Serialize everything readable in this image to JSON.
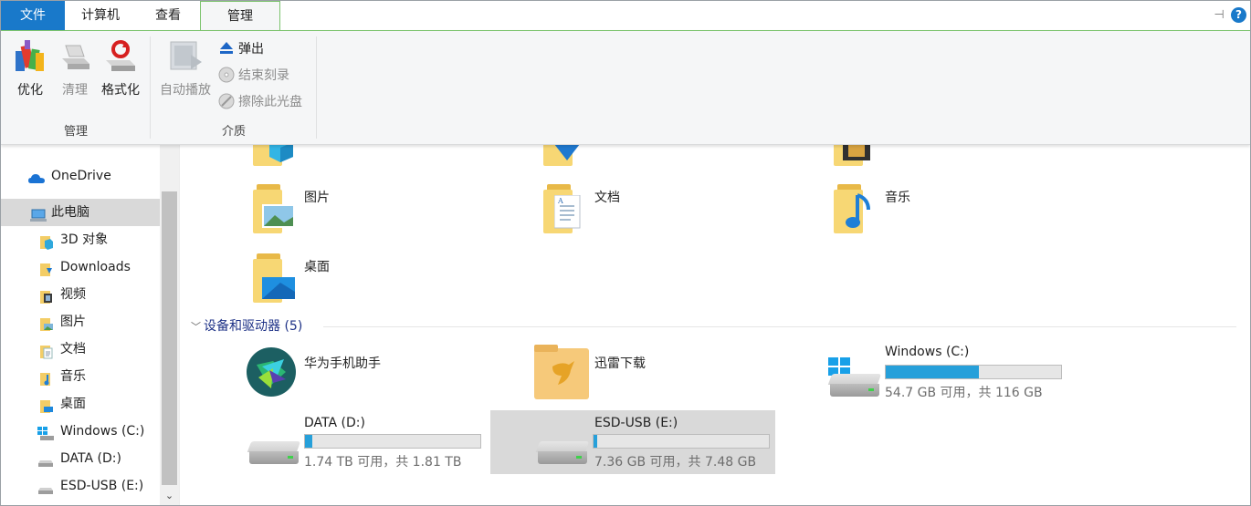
{
  "tabs": {
    "file": "文件",
    "computer": "计算机",
    "view": "查看",
    "manage": "管理"
  },
  "ribbon": {
    "optimize": "优化",
    "cleanup": "清理",
    "format": "格式化",
    "group_manage": "管理",
    "autoplay": "自动播放",
    "eject": "弹出",
    "finish_burn": "结束刻录",
    "erase_disc": "擦除此光盘",
    "group_media": "介质"
  },
  "nav": {
    "items": [
      {
        "label": "OneDrive"
      },
      {
        "label": "此电脑"
      },
      {
        "label": "3D 对象"
      },
      {
        "label": "Downloads"
      },
      {
        "label": "视频"
      },
      {
        "label": "图片"
      },
      {
        "label": "文档"
      },
      {
        "label": "音乐"
      },
      {
        "label": "桌面"
      },
      {
        "label": "Windows (C:)"
      },
      {
        "label": "DATA (D:)"
      },
      {
        "label": "ESD-USB (E:)"
      }
    ]
  },
  "folders": {
    "pictures": "图片",
    "documents": "文档",
    "music": "音乐",
    "desktop": "桌面"
  },
  "devices": {
    "header": "设备和驱动器 (5)",
    "huawei": "华为手机助手",
    "xunlei": "迅雷下载",
    "c_name": "Windows (C:)",
    "c_free": "54.7 GB 可用，共 116 GB",
    "c_used": 0.53,
    "d_name": "DATA (D:)",
    "d_free": "1.74 TB 可用，共 1.81 TB",
    "d_used": 0.04,
    "e_name": "ESD-USB (E:)",
    "e_free": "7.36 GB 可用，共 7.48 GB",
    "e_used": 0.02
  },
  "colors": {
    "accent": "#1979ca",
    "bar_fill": "#26a0da",
    "manage_tab_border": "#7cc36d"
  }
}
